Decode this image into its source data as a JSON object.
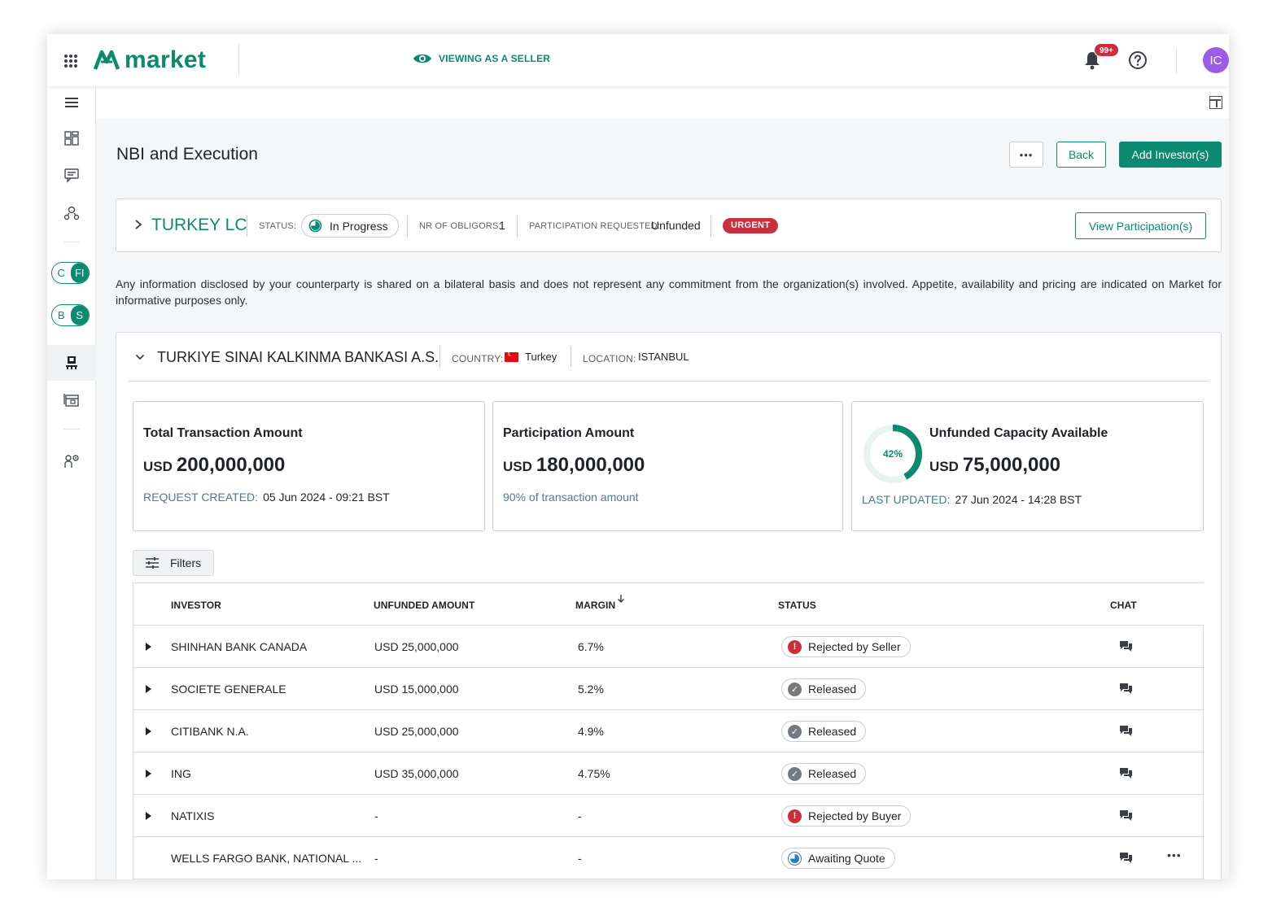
{
  "colors": {
    "brand": "#0b8a6f",
    "danger": "#c9303f",
    "avatar": "#9b5de5"
  },
  "topbar": {
    "logo_text": "market",
    "view_mode": "VIEWING AS A SELLER",
    "notification_badge": "99+",
    "avatar_initials": "IC",
    "icons": [
      "apps-grid-icon",
      "eye-icon",
      "bell-icon",
      "help-icon"
    ]
  },
  "sidebar": {
    "toggle_1": {
      "left": "C",
      "right": "FI",
      "selected": "FI"
    },
    "toggle_2": {
      "left": "B",
      "right": "S",
      "selected": "S"
    },
    "icons": [
      "menu-icon",
      "dashboard-icon",
      "chat-list-icon",
      "network-icon",
      "deals-icon",
      "calendar-icon",
      "settings-users-icon"
    ]
  },
  "page": {
    "title": "NBI and Execution",
    "more_label": "•••",
    "back_label": "Back",
    "add_label": "Add Investor(s)"
  },
  "deal": {
    "name": "TURKEY LC",
    "status_label": "STATUS:",
    "status_value": "In Progress",
    "obligors_label": "NR OF OBLIGORS:",
    "obligors_value": "1",
    "participation_label": "PARTICIPATION REQUESTED:",
    "participation_value": "Unfunded",
    "urgent_badge": "URGENT",
    "view_participation_label": "View Participation(s)"
  },
  "disclaimer": "Any information disclosed by your counterparty is shared on a bilateral basis and does not represent any commitment from the organization(s) involved. Appetite, availability and pricing are indicated on Market for informative purposes only.",
  "counterparty": {
    "name": "TURKIYE SINAI KALKINMA BANKASI A.S.",
    "country_label": "COUNTRY:",
    "country_value": "Turkey",
    "location_label": "LOCATION:",
    "location_value": "ISTANBUL"
  },
  "cards": {
    "total": {
      "title": "Total Transaction Amount",
      "currency": "USD",
      "amount": "200,000,000",
      "sub_label": "REQUEST CREATED:",
      "sub_value": "05 Jun 2024 - 09:21 BST"
    },
    "participation": {
      "title": "Participation Amount",
      "currency": "USD",
      "amount": "180,000,000",
      "sub_label": "90% of transaction amount"
    },
    "unfunded": {
      "title": "Unfunded Capacity Available",
      "currency": "USD",
      "amount": "75,000,000",
      "percent_label": "42%",
      "percent_value": 0.42,
      "sub_label": "LAST UPDATED:",
      "sub_value": "27 Jun 2024 - 14:28 BST"
    }
  },
  "filters_label": "Filters",
  "table": {
    "headers": {
      "investor": "INVESTOR",
      "amount": "UNFUNDED AMOUNT",
      "margin": "MARGIN",
      "status": "STATUS",
      "chat": "CHAT"
    },
    "rows": [
      {
        "investor": "SHINHAN BANK CANADA",
        "amount": "USD 25,000,000",
        "margin": "6.7%",
        "status": "Rejected by Seller",
        "status_kind": "rejected",
        "expandable": true
      },
      {
        "investor": "SOCIETE GENERALE",
        "amount": "USD 15,000,000",
        "margin": "5.2%",
        "status": "Released",
        "status_kind": "released",
        "expandable": true
      },
      {
        "investor": "CITIBANK N.A.",
        "amount": "USD 25,000,000",
        "margin": "4.9%",
        "status": "Released",
        "status_kind": "released",
        "expandable": true
      },
      {
        "investor": "ING",
        "amount": "USD 35,000,000",
        "margin": "4.75%",
        "status": "Released",
        "status_kind": "released",
        "expandable": true
      },
      {
        "investor": "NATIXIS",
        "amount": "-",
        "margin": "-",
        "status": "Rejected by Buyer",
        "status_kind": "rejected",
        "expandable": true
      },
      {
        "investor": "WELLS FARGO BANK, NATIONAL ...",
        "amount": "-",
        "margin": "-",
        "status": "Awaiting Quote",
        "status_kind": "awaiting",
        "expandable": false,
        "more": "•••"
      }
    ]
  }
}
